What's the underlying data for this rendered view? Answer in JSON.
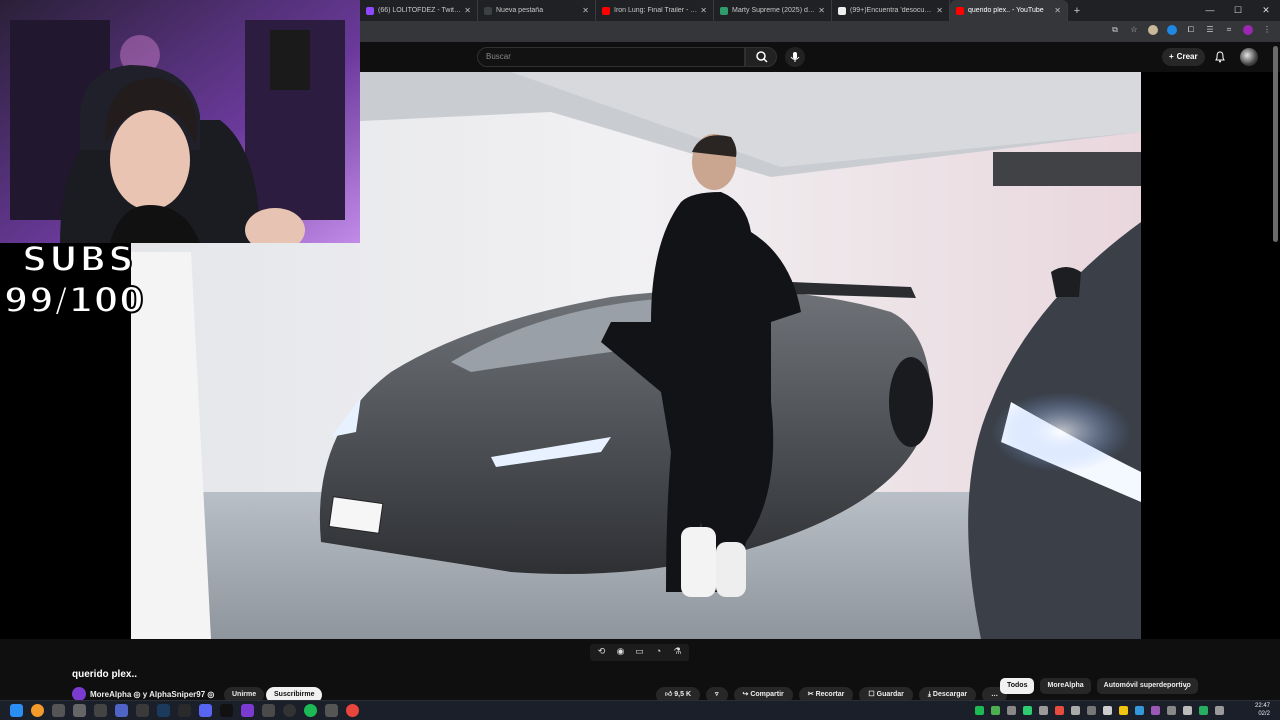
{
  "browser": {
    "tabs": [
      {
        "title": "(66) LOLITOFDEZ - Twitch",
        "favicon_color": "#9146ff"
      },
      {
        "title": "Nueva pestaña",
        "favicon_color": "#3c4043"
      },
      {
        "title": "Iron Lung: Final Trailer - YouTub",
        "favicon_color": "#ff0000"
      },
      {
        "title": "Marty Supreme (2025) directed",
        "favicon_color": "#2e9d6b"
      },
      {
        "title": "(99+)Encuentra 'desocupacyl g",
        "favicon_color": "#eeeeee"
      },
      {
        "title": "querido plex.. - YouTube",
        "favicon_color": "#ff0000"
      }
    ],
    "new_tab": "+"
  },
  "youtube": {
    "search_placeholder": "Buscar",
    "create_label": "Crear"
  },
  "overlay": {
    "subs_label": "SUBS",
    "subs_count": "99/100"
  },
  "video": {
    "title": "querido plex..",
    "channel": "MoreAlpha ◎ y AlphaSniper97 ◎",
    "join_label": "Unirme",
    "subscribe_label": "Suscribirme",
    "likes": "9,5 K",
    "actions": [
      "Compartir",
      "Recortar",
      "Guardar",
      "Descargar"
    ],
    "more": "…"
  },
  "chips": [
    "Todos",
    "MoreAlpha",
    "Automóvil superdeportivo"
  ],
  "clock": {
    "time": "22:47",
    "date": "02/2"
  },
  "colors": {
    "yt_bg": "#0f0f0f",
    "accent_red": "#ff0000"
  }
}
